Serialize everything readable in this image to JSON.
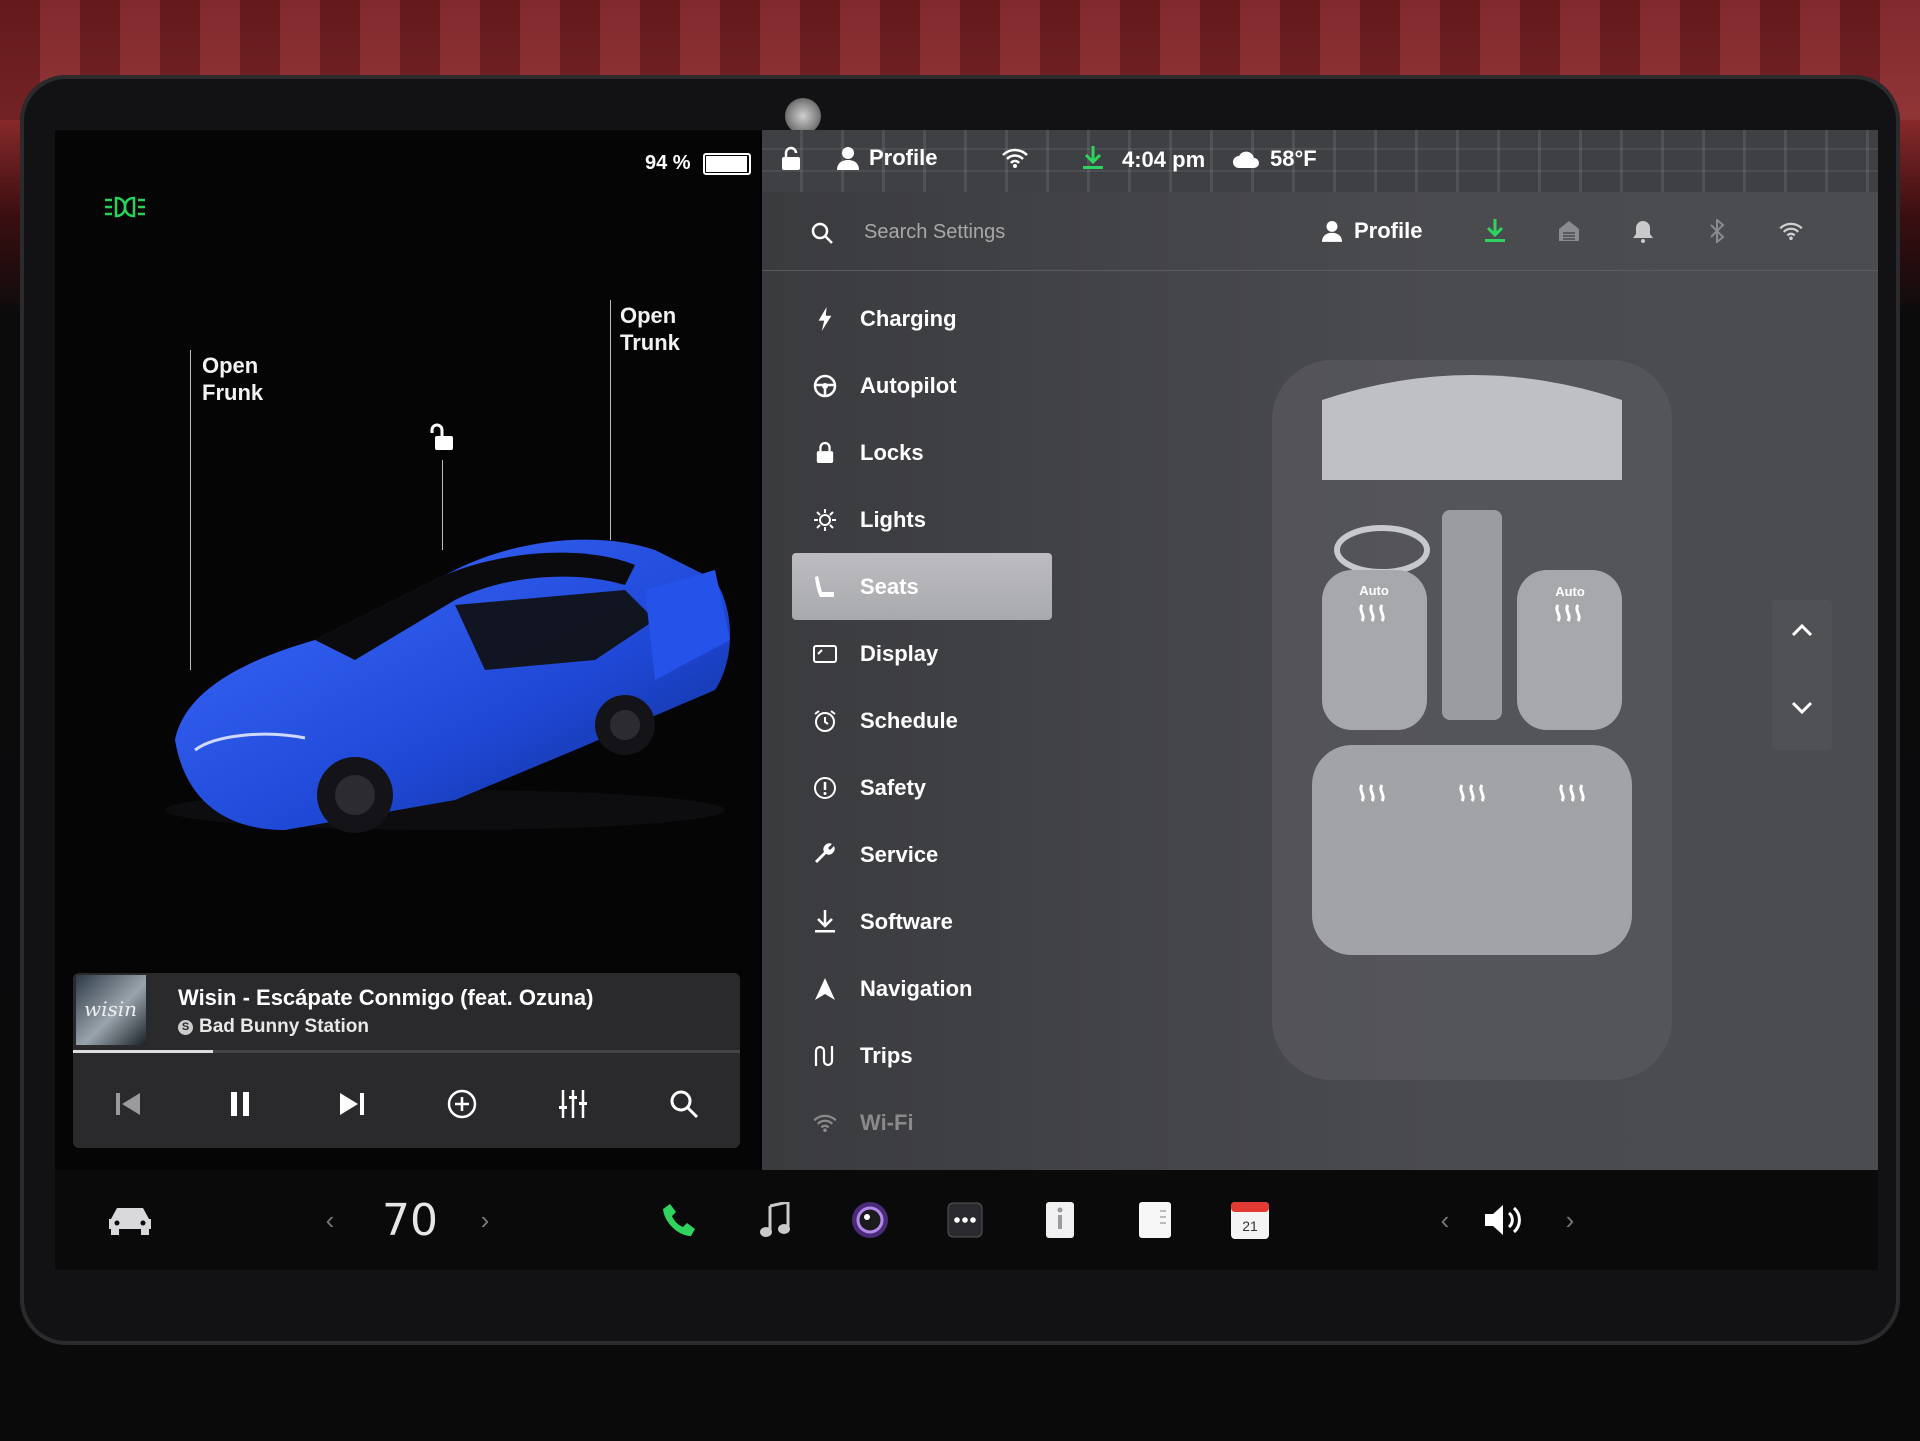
{
  "status": {
    "battery_percent": "94 %",
    "battery_level": 0.94,
    "profile_label": "Profile",
    "time": "4:04 pm",
    "temperature": "58°F"
  },
  "vehicle": {
    "frunk": {
      "line1": "Open",
      "line2": "Frunk"
    },
    "trunk": {
      "line1": "Open",
      "line2": "Trunk"
    },
    "paint_color": "#1f48d6",
    "headlight_color": "#26d35a"
  },
  "media": {
    "song": "Wisin - Escápate Conmigo (feat. Ozuna)",
    "station": "Bad Bunny Station",
    "progress": 0.21
  },
  "settings": {
    "search_placeholder": "Search Settings",
    "profile_label": "Profile",
    "download_color": "#2fd45e",
    "menu": [
      {
        "label": "Charging",
        "icon": "bolt-icon"
      },
      {
        "label": "Autopilot",
        "icon": "steering-wheel-icon"
      },
      {
        "label": "Locks",
        "icon": "lock-icon"
      },
      {
        "label": "Lights",
        "icon": "sun-icon"
      },
      {
        "label": "Seats",
        "icon": "seat-icon",
        "active": true
      },
      {
        "label": "Display",
        "icon": "display-icon"
      },
      {
        "label": "Schedule",
        "icon": "alarm-clock-icon"
      },
      {
        "label": "Safety",
        "icon": "exclamation-circle-icon"
      },
      {
        "label": "Service",
        "icon": "wrench-icon"
      },
      {
        "label": "Software",
        "icon": "download-icon"
      },
      {
        "label": "Navigation",
        "icon": "navigation-arrow-icon"
      },
      {
        "label": "Trips",
        "icon": "trips-icon"
      },
      {
        "label": "Wi-Fi",
        "icon": "wifi-icon"
      }
    ],
    "seats": {
      "front_left_label": "Auto",
      "front_right_label": "Auto"
    }
  },
  "dock": {
    "cabin_temp": "70",
    "calendar_day": "21"
  }
}
